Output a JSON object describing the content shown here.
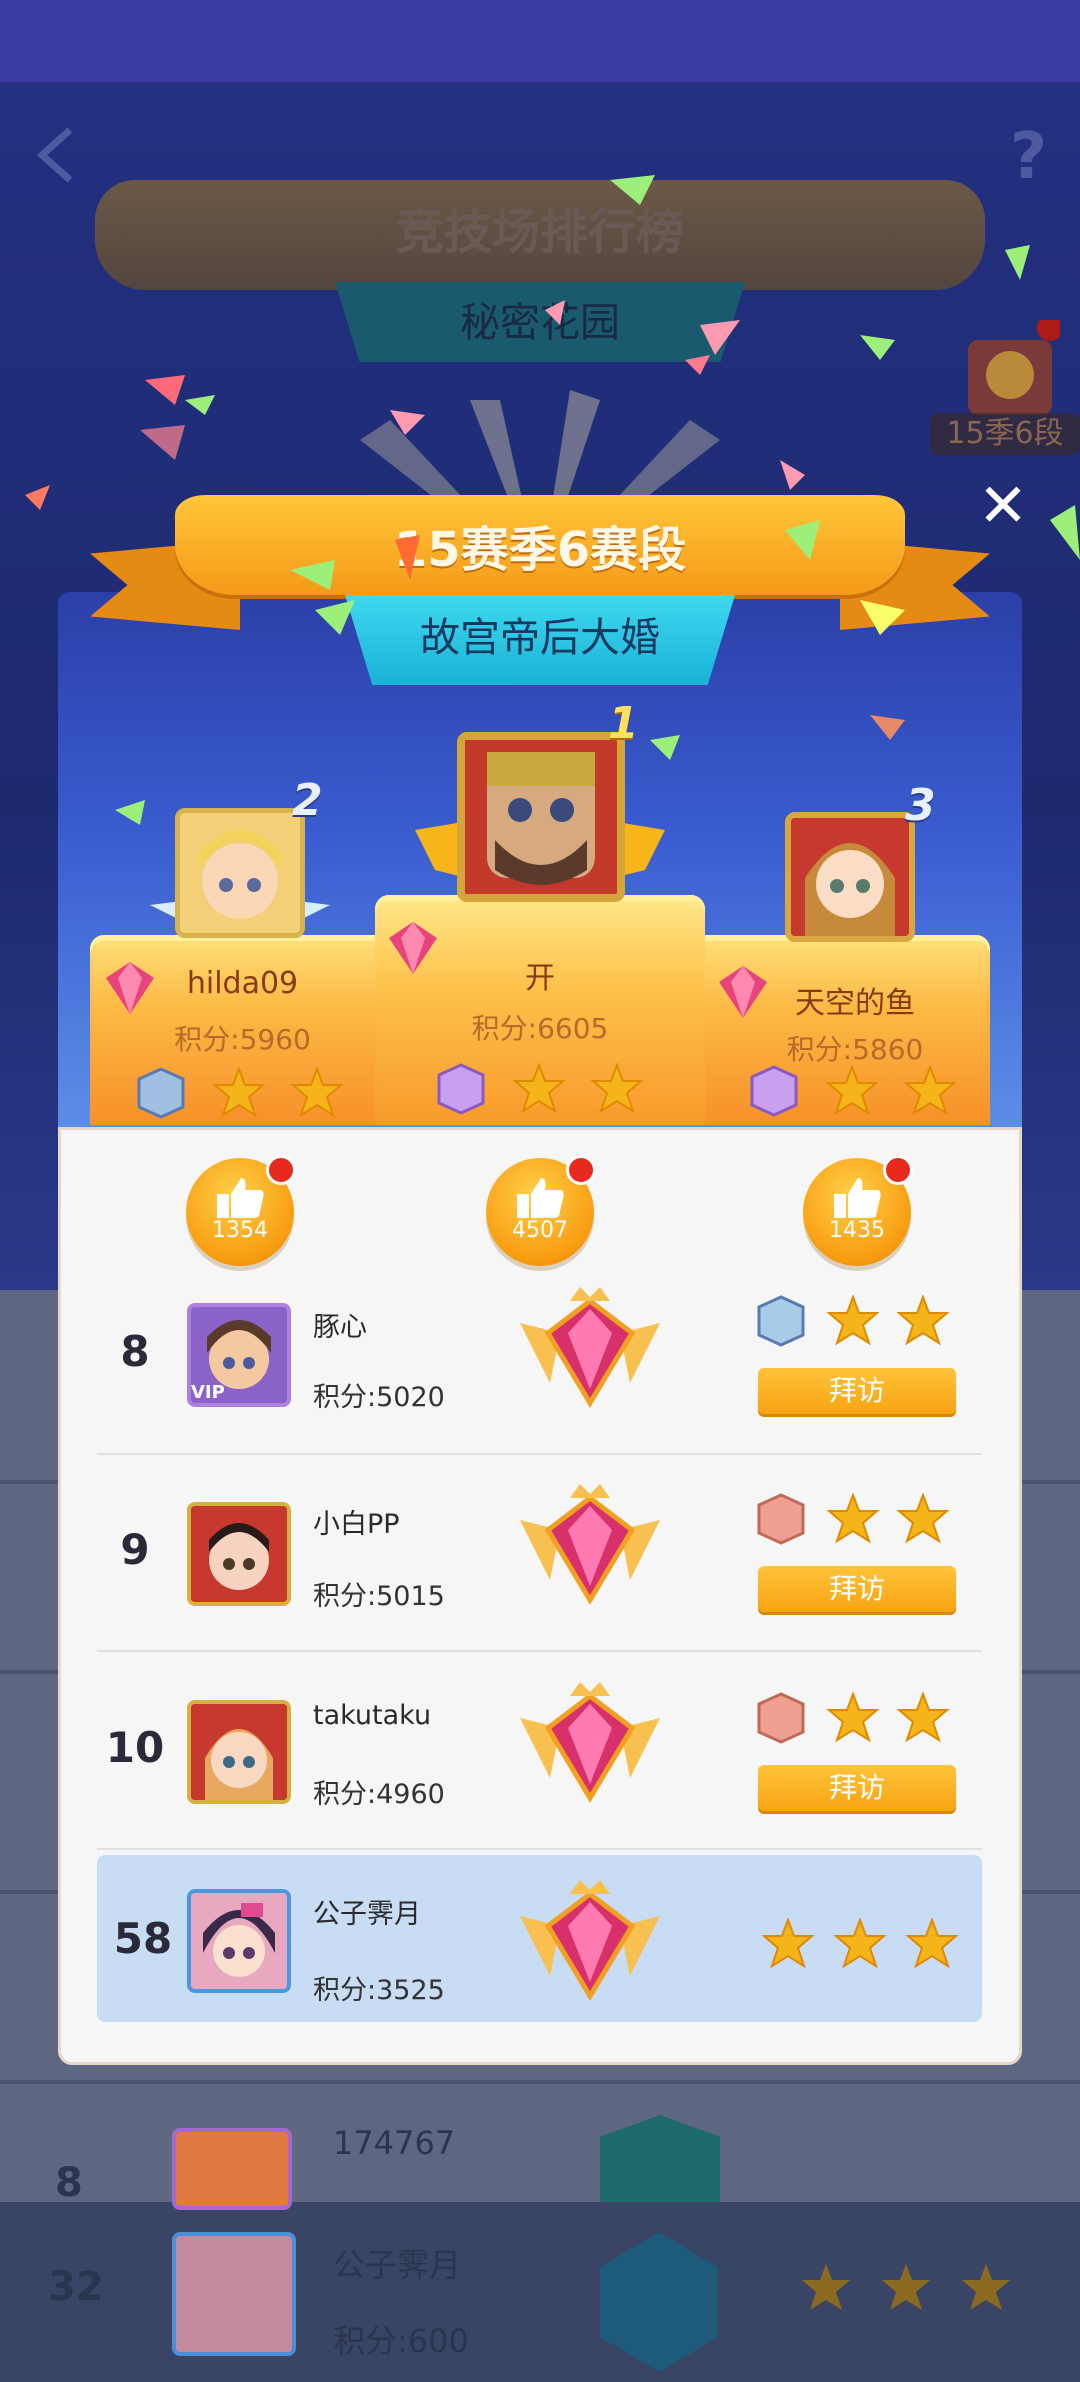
{
  "background": {
    "title": "竞技场排行榜",
    "subtitle": "秘密花园",
    "season_badge": "15季6段",
    "rows": [
      {
        "rank": "8",
        "name": "174767"
      },
      {
        "rank": "32",
        "name": "公子霁月",
        "score": "积分:600"
      }
    ]
  },
  "popup": {
    "title": "15赛季6赛段",
    "subtitle": "故宫帝后大婚",
    "close": "✕",
    "podium": [
      {
        "rank": "2",
        "name": "hilda09",
        "score": "积分:5960",
        "likes": "1354"
      },
      {
        "rank": "1",
        "name": "开",
        "score": "积分:6605",
        "likes": "4507"
      },
      {
        "rank": "3",
        "name": "天空的鱼",
        "score": "积分:5860",
        "likes": "1435"
      }
    ],
    "list": [
      {
        "rank": "8",
        "name": "豚心",
        "score": "积分:5020",
        "vip": "VIP",
        "visit": "拜访"
      },
      {
        "rank": "9",
        "name": "小白PP",
        "score": "积分:5015",
        "visit": "拜访"
      },
      {
        "rank": "10",
        "name": "takutaku",
        "score": "积分:4960",
        "visit": "拜访"
      }
    ],
    "me": {
      "rank": "58",
      "name": "公子霁月",
      "score": "积分:3525"
    }
  },
  "colors": {
    "accent": "#f7a412",
    "highlight_row": "#c8dcf4",
    "popup_top": "#3a5ccf"
  }
}
